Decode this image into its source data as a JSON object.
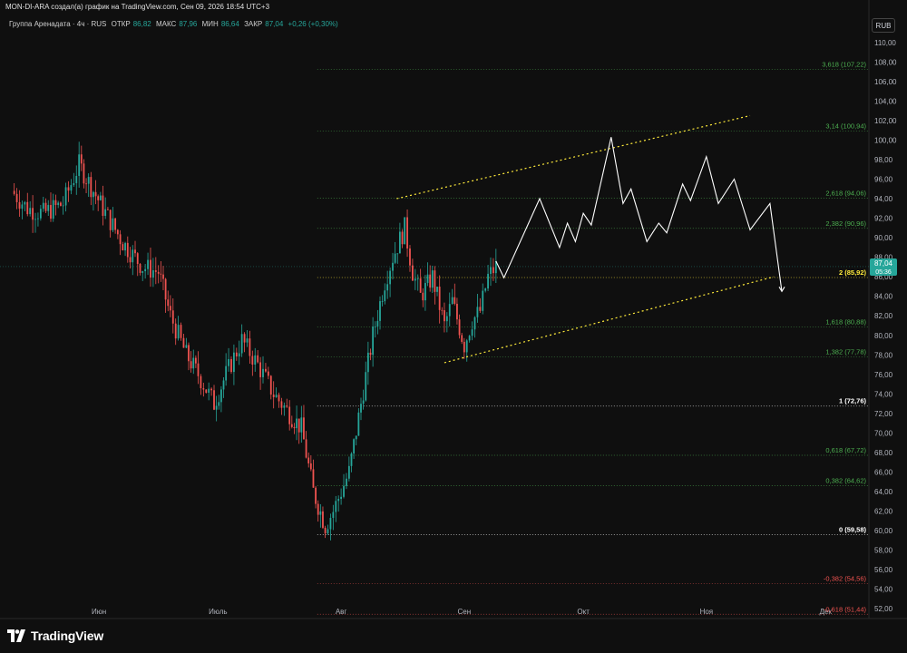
{
  "header": {
    "attribution": "MON-DI-ARA создал(а) график на TradingView.com, Сен 09, 2026 18:54 UTC+3"
  },
  "legend": {
    "symbol": "Группа Аренадата · 4ч · RUS",
    "open_label": "ОТКР",
    "open": "86,82",
    "high_label": "МАКС",
    "high": "87,96",
    "low_label": "МИН",
    "low": "86,64",
    "close_label": "ЗАКР",
    "close": "87,04",
    "change": "+0,26 (+0,30%)"
  },
  "currency_button": "RUB",
  "brand": "TradingView",
  "colors": {
    "background": "#0f0f0f",
    "up": "#26a69a",
    "down": "#ef5350",
    "fib_green": "#4caf50",
    "fib_red": "#ef5350",
    "fib_white": "#ffffff",
    "fib_yellow": "#ffeb3b",
    "channel": "#ffeb3b",
    "projection": "#ffffff",
    "price_tag": "#26a69a"
  },
  "chart_data": {
    "type": "candlestick",
    "symbol": "Группа Аренадата",
    "timeframe": "4ч",
    "y_axis": {
      "min": 51,
      "max": 111,
      "ticks": [
        52,
        54,
        56,
        58,
        60,
        62,
        64,
        66,
        68,
        70,
        72,
        74,
        76,
        78,
        80,
        82,
        84,
        86,
        88,
        90,
        92,
        94,
        96,
        98,
        100,
        102,
        104,
        106,
        108,
        110
      ],
      "tick_labels": [
        "52,00",
        "54,00",
        "56,00",
        "58,00",
        "60,00",
        "62,00",
        "64,00",
        "66,00",
        "68,00",
        "70,00",
        "72,00",
        "74,00",
        "76,00",
        "78,00",
        "80,00",
        "82,00",
        "84,00",
        "86,00",
        "88,00",
        "90,00",
        "92,00",
        "94,00",
        "96,00",
        "98,00",
        "100,00",
        "102,00",
        "104,00",
        "106,00",
        "108,00",
        "110,00"
      ]
    },
    "x_axis": {
      "labels": [
        "Июн",
        "Июль",
        "Авг",
        "Сен",
        "Окт",
        "Ноя",
        "Дек"
      ],
      "label_dates": [
        "2026-06-01",
        "2026-07-01",
        "2026-08-01",
        "2026-09-01",
        "2026-10-01",
        "2026-11-01",
        "2026-12-01"
      ]
    },
    "last_price": {
      "value": 87.04,
      "label": "87,04",
      "countdown": "05:36"
    },
    "price_path_approx": [
      [
        "2026-05-10",
        94.8
      ],
      [
        "2026-05-14",
        93.0
      ],
      [
        "2026-05-18",
        92.5
      ],
      [
        "2026-05-23",
        93.5
      ],
      [
        "2026-05-27",
        97.5
      ],
      [
        "2026-06-02",
        93.0
      ],
      [
        "2026-06-07",
        89.5
      ],
      [
        "2026-06-12",
        87.0
      ],
      [
        "2026-06-16",
        86.5
      ],
      [
        "2026-06-19",
        82.0
      ],
      [
        "2026-06-23",
        78.0
      ],
      [
        "2026-06-26",
        76.0
      ],
      [
        "2026-06-30",
        73.0
      ],
      [
        "2026-07-03",
        76.0
      ],
      [
        "2026-07-07",
        79.5
      ],
      [
        "2026-07-11",
        77.0
      ],
      [
        "2026-07-15",
        74.0
      ],
      [
        "2026-07-19",
        72.0
      ],
      [
        "2026-07-22",
        70.5
      ],
      [
        "2026-07-25",
        64.0
      ],
      [
        "2026-07-28",
        60.5
      ],
      [
        "2026-07-30",
        62.0
      ],
      [
        "2026-08-03",
        66.0
      ],
      [
        "2026-08-06",
        73.0
      ],
      [
        "2026-08-09",
        80.0
      ],
      [
        "2026-08-12",
        85.5
      ],
      [
        "2026-08-14",
        88.0
      ],
      [
        "2026-08-17",
        91.0
      ],
      [
        "2026-08-19",
        86.5
      ],
      [
        "2026-08-21",
        84.0
      ],
      [
        "2026-08-24",
        86.0
      ],
      [
        "2026-08-27",
        81.0
      ],
      [
        "2026-08-29",
        83.5
      ],
      [
        "2026-09-01",
        79.0
      ],
      [
        "2026-09-03",
        81.5
      ],
      [
        "2026-09-05",
        82.5
      ],
      [
        "2026-09-07",
        86.0
      ],
      [
        "2026-09-09",
        87.04
      ]
    ],
    "fibonacci_levels": [
      {
        "ratio": "-0,618",
        "price": 51.44,
        "label": "-0,618 (51,44)",
        "color": "red"
      },
      {
        "ratio": "-0,382",
        "price": 54.56,
        "label": "-0,382 (54,56)",
        "color": "red"
      },
      {
        "ratio": "0",
        "price": 59.58,
        "label": "0 (59,58)",
        "color": "white"
      },
      {
        "ratio": "0,382",
        "price": 64.62,
        "label": "0,382 (64,62)",
        "color": "green"
      },
      {
        "ratio": "0,618",
        "price": 67.72,
        "label": "0,618 (67,72)",
        "color": "green"
      },
      {
        "ratio": "1",
        "price": 72.76,
        "label": "1 (72,76)",
        "color": "white"
      },
      {
        "ratio": "1,382",
        "price": 77.78,
        "label": "1,382 (77,78)",
        "color": "green"
      },
      {
        "ratio": "1,618",
        "price": 80.88,
        "label": "1,618 (80,88)",
        "color": "green"
      },
      {
        "ratio": "2",
        "price": 85.92,
        "label": "2 (85,92)",
        "color": "yellow"
      },
      {
        "ratio": "2,382",
        "price": 90.96,
        "label": "2,382 (90,96)",
        "color": "green"
      },
      {
        "ratio": "2,618",
        "price": 94.06,
        "label": "2,618 (94,06)",
        "color": "green"
      },
      {
        "ratio": "3,14",
        "price": 100.94,
        "label": "3,14 (100,94)",
        "color": "green"
      },
      {
        "ratio": "3,618",
        "price": 107.22,
        "label": "3,618 (107,22)",
        "color": "green"
      }
    ],
    "fib_start_date": "2026-07-26",
    "channel_upper": [
      [
        "2026-08-15",
        94.0
      ],
      [
        "2026-11-12",
        102.5
      ]
    ],
    "channel_lower": [
      [
        "2026-08-27",
        77.2
      ],
      [
        "2026-11-18",
        86.0
      ]
    ],
    "projection_path": [
      [
        "2026-09-09",
        87.6
      ],
      [
        "2026-09-11",
        85.9
      ],
      [
        "2026-09-20",
        94.0
      ],
      [
        "2026-09-25",
        89.0
      ],
      [
        "2026-09-27",
        91.5
      ],
      [
        "2026-09-29",
        89.6
      ],
      [
        "2026-10-01",
        92.5
      ],
      [
        "2026-10-03",
        91.3
      ],
      [
        "2026-10-08",
        100.3
      ],
      [
        "2026-10-11",
        93.5
      ],
      [
        "2026-10-13",
        95.0
      ],
      [
        "2026-10-17",
        89.6
      ],
      [
        "2026-10-20",
        91.5
      ],
      [
        "2026-10-22",
        90.5
      ],
      [
        "2026-10-26",
        95.5
      ],
      [
        "2026-10-28",
        93.8
      ],
      [
        "2026-11-01",
        98.3
      ],
      [
        "2026-11-04",
        93.5
      ],
      [
        "2026-11-08",
        96.0
      ],
      [
        "2026-11-12",
        90.8
      ],
      [
        "2026-11-17",
        93.5
      ],
      [
        "2026-11-20",
        84.5
      ]
    ]
  }
}
